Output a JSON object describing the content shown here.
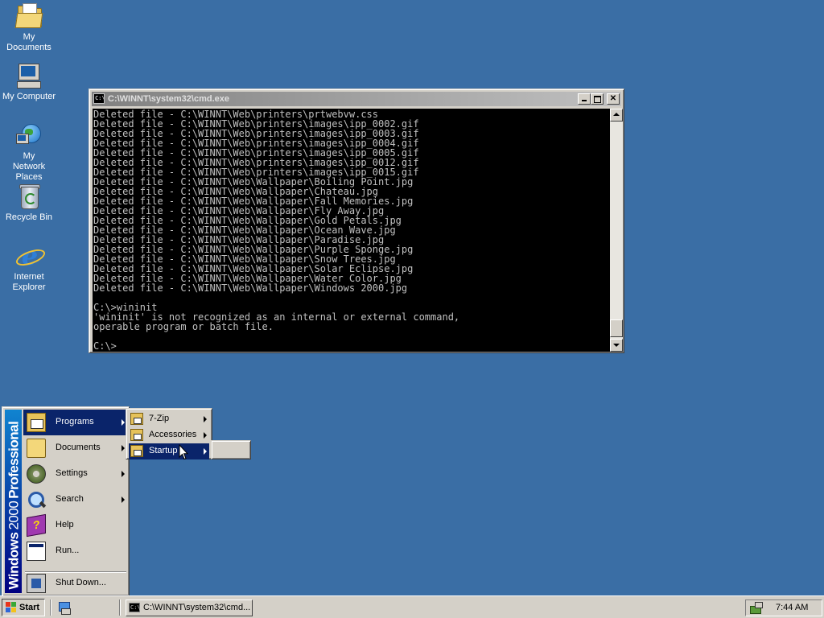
{
  "desktop": {
    "icons": [
      {
        "label": "My Documents",
        "icon": "my-documents-icon"
      },
      {
        "label": "My Computer",
        "icon": "my-computer-icon"
      },
      {
        "label": "My Network Places",
        "icon": "network-places-icon"
      },
      {
        "label": "Recycle Bin",
        "icon": "recycle-bin-icon"
      },
      {
        "label": "Internet Explorer",
        "icon": "internet-explorer-icon"
      }
    ],
    "background_color": "#3a6ea5"
  },
  "cmd_window": {
    "title": "C:\\WINNT\\system32\\cmd.exe",
    "icon_text": "C:\\",
    "lines": [
      "Deleted file - C:\\WINNT\\Web\\printers\\prtwebvw.css",
      "Deleted file - C:\\WINNT\\Web\\printers\\images\\ipp_0002.gif",
      "Deleted file - C:\\WINNT\\Web\\printers\\images\\ipp_0003.gif",
      "Deleted file - C:\\WINNT\\Web\\printers\\images\\ipp_0004.gif",
      "Deleted file - C:\\WINNT\\Web\\printers\\images\\ipp_0005.gif",
      "Deleted file - C:\\WINNT\\Web\\printers\\images\\ipp_0012.gif",
      "Deleted file - C:\\WINNT\\Web\\printers\\images\\ipp_0015.gif",
      "Deleted file - C:\\WINNT\\Web\\Wallpaper\\Boiling Point.jpg",
      "Deleted file - C:\\WINNT\\Web\\Wallpaper\\Chateau.jpg",
      "Deleted file - C:\\WINNT\\Web\\Wallpaper\\Fall Memories.jpg",
      "Deleted file - C:\\WINNT\\Web\\Wallpaper\\Fly Away.jpg",
      "Deleted file - C:\\WINNT\\Web\\Wallpaper\\Gold Petals.jpg",
      "Deleted file - C:\\WINNT\\Web\\Wallpaper\\Ocean Wave.jpg",
      "Deleted file - C:\\WINNT\\Web\\Wallpaper\\Paradise.jpg",
      "Deleted file - C:\\WINNT\\Web\\Wallpaper\\Purple Sponge.jpg",
      "Deleted file - C:\\WINNT\\Web\\Wallpaper\\Snow Trees.jpg",
      "Deleted file - C:\\WINNT\\Web\\Wallpaper\\Solar Eclipse.jpg",
      "Deleted file - C:\\WINNT\\Web\\Wallpaper\\Water Color.jpg",
      "Deleted file - C:\\WINNT\\Web\\Wallpaper\\Windows 2000.jpg",
      "",
      "C:\\>wininit",
      "'wininit' is not recognized as an internal or external command,",
      "operable program or batch file.",
      "",
      "C:\\>"
    ]
  },
  "start_menu": {
    "banner_bold": "Windows",
    "banner_light": "2000",
    "banner_edition": "Professional",
    "items": [
      {
        "label": "Programs",
        "has_submenu": true,
        "highlighted": true,
        "icon": "programs-icon"
      },
      {
        "label": "Documents",
        "has_submenu": true,
        "highlighted": false,
        "icon": "documents-icon"
      },
      {
        "label": "Settings",
        "has_submenu": true,
        "highlighted": false,
        "icon": "settings-icon"
      },
      {
        "label": "Search",
        "has_submenu": true,
        "highlighted": false,
        "icon": "search-icon"
      },
      {
        "label": "Help",
        "has_submenu": false,
        "highlighted": false,
        "icon": "help-icon"
      },
      {
        "label": "Run...",
        "has_submenu": false,
        "highlighted": false,
        "icon": "run-icon"
      },
      {
        "label": "Shut Down...",
        "has_submenu": false,
        "highlighted": false,
        "icon": "shut-down-icon"
      }
    ],
    "highlight_color": "#0a246a"
  },
  "programs_submenu": {
    "items": [
      {
        "label": "7-Zip",
        "has_submenu": true,
        "highlighted": false
      },
      {
        "label": "Accessories",
        "has_submenu": true,
        "highlighted": false
      },
      {
        "label": "Startup",
        "has_submenu": true,
        "highlighted": true
      }
    ]
  },
  "taskbar": {
    "start_label": "Start",
    "task_button_label": "C:\\WINNT\\system32\\cmd...",
    "clock": "7:44 AM"
  }
}
